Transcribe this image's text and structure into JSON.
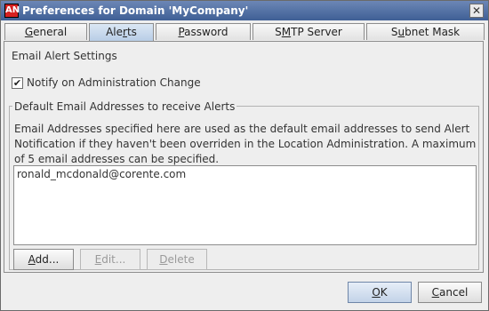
{
  "window": {
    "title": "Preferences for Domain 'MyCompany'",
    "icon_letters": "AN",
    "close_glyph": "✕"
  },
  "tabs": [
    {
      "label_prefix": "",
      "mnemonic": "G",
      "label_rest": "eneral",
      "active": false
    },
    {
      "label_prefix": "Ale",
      "mnemonic": "r",
      "label_rest": "ts",
      "active": true
    },
    {
      "label_prefix": "",
      "mnemonic": "P",
      "label_rest": "assword",
      "active": false
    },
    {
      "label_prefix": "S",
      "mnemonic": "M",
      "label_rest": "TP Server",
      "active": false
    },
    {
      "label_prefix": "S",
      "mnemonic": "u",
      "label_rest": "bnet Mask",
      "active": false
    }
  ],
  "alerts": {
    "section_title": "Email Alert Settings",
    "notify_checkbox": {
      "label": "Notify on Administration Change",
      "checked": true,
      "glyph": "✔"
    },
    "group_title": "Default Email Addresses to receive Alerts",
    "description": "Email Addresses specified here are used as the default email addresses to send Alert Notification if they haven't been overriden in the Location Administration.  A maximum of 5 email addresses can be specified.",
    "emails": [
      "ronald_mcdonald@corente.com"
    ],
    "buttons": {
      "add": {
        "mnemonic": "A",
        "rest": "dd..."
      },
      "edit": {
        "mnemonic": "E",
        "rest": "dit..."
      },
      "delete": {
        "mnemonic": "D",
        "rest": "elete"
      }
    }
  },
  "footer": {
    "ok": {
      "mnemonic": "O",
      "rest": "K"
    },
    "cancel": {
      "mnemonic": "C",
      "rest": "ancel"
    }
  }
}
